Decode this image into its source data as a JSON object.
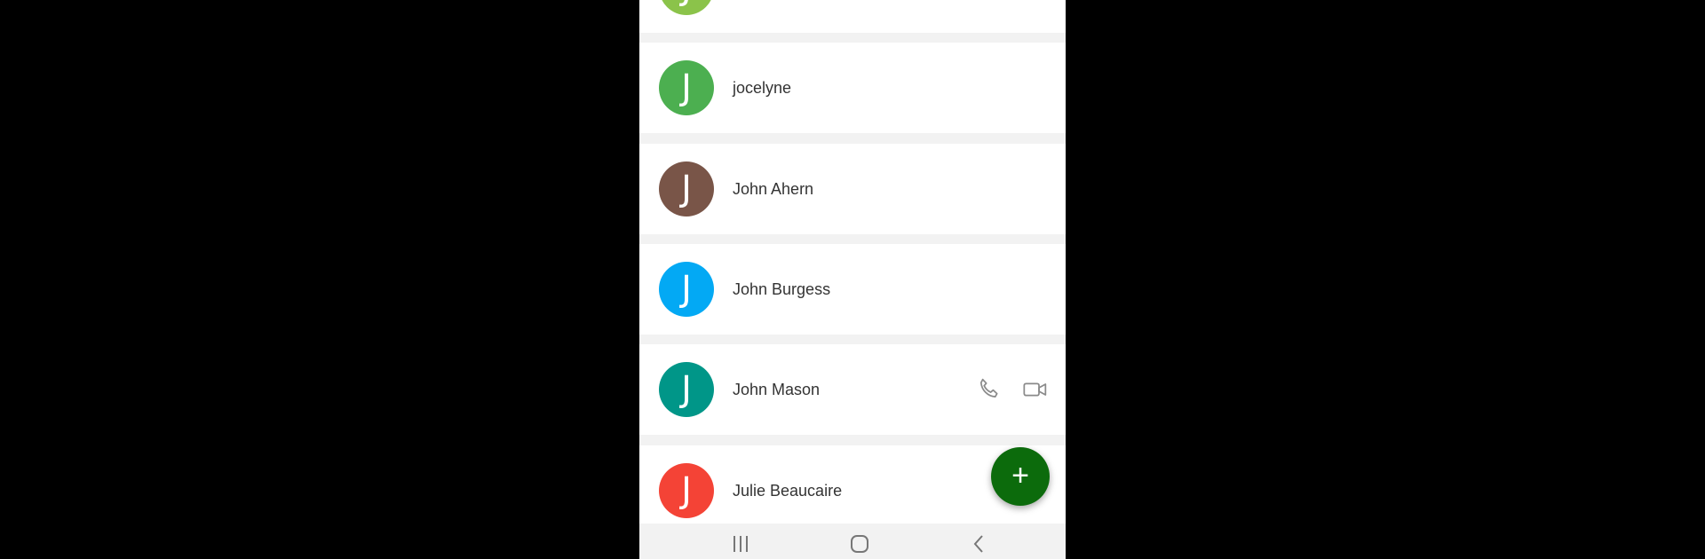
{
  "contacts": [
    {
      "initial": "J",
      "name": "",
      "color": "#8bc34a"
    },
    {
      "initial": "J",
      "name": "jocelyne",
      "color": "#4caf50"
    },
    {
      "initial": "J",
      "name": "John Ahern",
      "color": "#795548"
    },
    {
      "initial": "J",
      "name": "John Burgess",
      "color": "#03a9f4"
    },
    {
      "initial": "J",
      "name": "John Mason",
      "color": "#009688"
    },
    {
      "initial": "J",
      "name": "Julie Beaucaire",
      "color": "#f44336"
    }
  ],
  "fab": {
    "label": "+"
  },
  "icons": {
    "call": "phone-icon",
    "video": "video-camera-icon",
    "recents": "recents-icon",
    "home": "home-icon",
    "back": "back-icon"
  }
}
